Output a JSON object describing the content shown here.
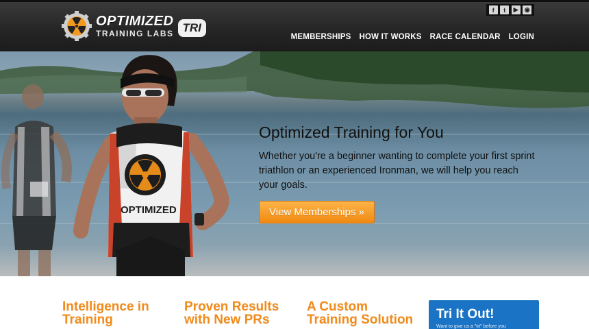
{
  "header": {
    "logo_line1": "OPTIMIZED",
    "logo_line2": "TRAINING LABS",
    "logo_badge": "TRI",
    "social": [
      {
        "icon": "facebook-icon",
        "glyph": "f"
      },
      {
        "icon": "twitter-icon",
        "glyph": "t"
      },
      {
        "icon": "youtube-icon",
        "glyph": "▶"
      },
      {
        "icon": "rss-icon",
        "glyph": "◉"
      }
    ],
    "nav": [
      "MEMBERSHIPS",
      "HOW IT WORKS",
      "RACE CALENDAR",
      "LOGIN"
    ]
  },
  "hero": {
    "title": "Optimized Training for You",
    "subtitle": "Whether you're a beginner wanting to complete your first sprint triathlon or an experienced Ironman, we will help you reach your goals.",
    "cta": "View Memberships »",
    "jersey_text": "OPTIMIZED"
  },
  "features": [
    {
      "title": "Intelligence in Training"
    },
    {
      "title": "Proven Results with New PRs"
    },
    {
      "title": "A Custom Training Solution"
    }
  ],
  "try_box": {
    "title": "Tri It Out!",
    "subtitle": "Want to give us a \"tri\" before you"
  },
  "colors": {
    "accent_orange": "#f28c1a",
    "button_orange": "#f39a2a",
    "try_blue": "#1a73c4",
    "header_dark": "#262626"
  }
}
